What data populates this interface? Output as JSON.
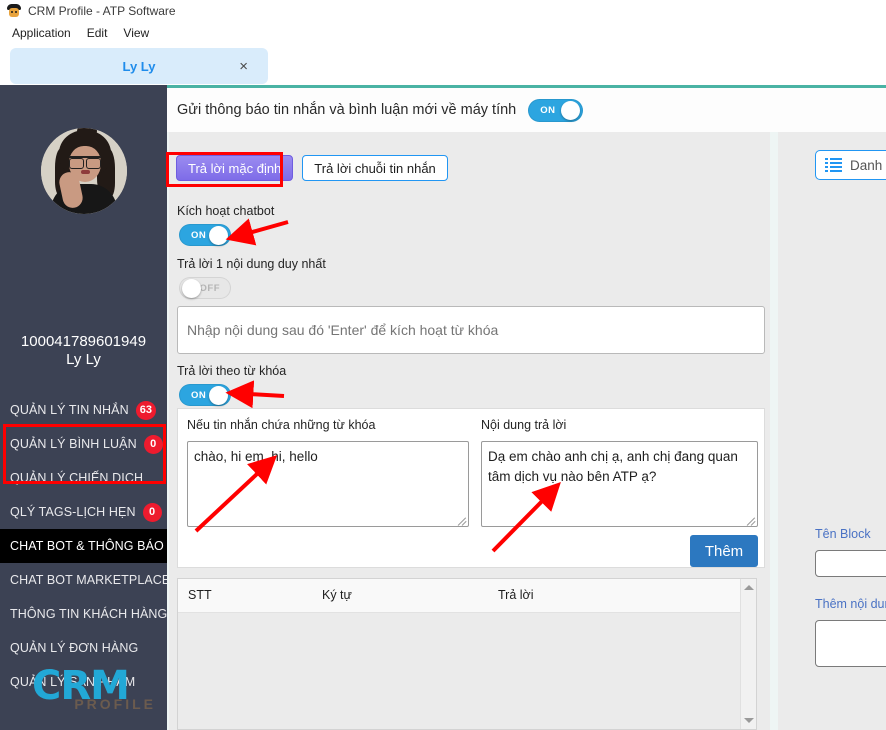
{
  "window": {
    "title": "CRM Profile - ATP Software",
    "icon": "app-icon"
  },
  "menubar": {
    "items": [
      {
        "label": "Application"
      },
      {
        "label": "Edit"
      },
      {
        "label": "View"
      }
    ]
  },
  "tabstrip": {
    "tabs": [
      {
        "label": "Ly Ly",
        "close": "×"
      }
    ]
  },
  "sidebar": {
    "account_id": "100041789601949",
    "account_name": "Ly Ly",
    "avatar": "user-avatar",
    "logo": {
      "primary": "CRM",
      "secondary": "PROFILE"
    },
    "items": [
      {
        "label": "QUẢN LÝ TIN NHẮN",
        "badge": "63",
        "active": false
      },
      {
        "label": "QUẢN LÝ BÌNH LUẬN",
        "badge": "0",
        "active": false
      },
      {
        "label": "QUẢN LÝ CHIẾN DỊCH",
        "badge": "",
        "active": false
      },
      {
        "label": "QLÝ TAGS-LỊCH HẸN",
        "badge": "0",
        "active": false
      },
      {
        "label": "CHAT BOT & THÔNG BÁO",
        "badge": "",
        "active": true
      },
      {
        "label": "CHAT BOT MARKETPLACE",
        "badge": "",
        "active": false
      },
      {
        "label": "THÔNG TIN KHÁCH HÀNG",
        "badge": "",
        "active": false
      },
      {
        "label": "QUẢN LÝ ĐƠN HÀNG",
        "badge": "",
        "active": false
      },
      {
        "label": "QUẢN LÝ SẢN PHẨM",
        "badge": "",
        "active": false
      }
    ]
  },
  "topbar": {
    "notify_label": "Gửi thông báo tin nhắn và bình luận mới về máy tính",
    "notify_toggle": "ON"
  },
  "main": {
    "tabs": [
      {
        "label": "Trả lời mặc định",
        "active": true
      },
      {
        "label": "Trả lời chuỗi tin nhắn",
        "active": false
      }
    ],
    "chatbot_enable_label": "Kích hoạt chatbot",
    "chatbot_enable_toggle": "ON",
    "single_reply_label": "Trả lời 1 nội dung duy nhất",
    "single_reply_toggle": "OFF",
    "keyword_activate_placeholder": "Nhập nội dung sau đó 'Enter' để kích hoạt từ khóa",
    "keyword_activate_value": "",
    "reply_by_keyword_label": "Trả lời theo từ khóa",
    "reply_by_keyword_toggle": "ON",
    "keyword_field_label": "Nếu tin nhắn chứa những từ khóa",
    "keyword_field_value": "chào, hi em, hi, hello",
    "reply_field_label": "Nội dung trả lời",
    "reply_field_value": "Dạ em chào anh chị ạ, anh chị đang quan tâm dịch vụ nào bên ATP ạ?",
    "add_button": "Thêm",
    "table": {
      "columns": [
        "STT",
        "Ký tự",
        "Trả lời"
      ],
      "rows": []
    }
  },
  "rightpanel": {
    "list_button": "Danh sách",
    "list_icon": "list-icon",
    "block_name_label": "Tên Block",
    "block_name_value": "",
    "add_content_label": "Thêm nội dung",
    "add_content_value": ""
  },
  "colors": {
    "sidebar_bg": "#3c4254",
    "accent_blue": "#2196f3",
    "badge_red": "#ee1b2e",
    "primary_violet": "#7e6ce8",
    "toggle_on": "#2ca5e0",
    "button_blue": "#2c78c0",
    "annotation_red": "#ff0000",
    "logo_cyan": "#22a8d6",
    "tab_underline_teal": "#4ab3a4"
  }
}
